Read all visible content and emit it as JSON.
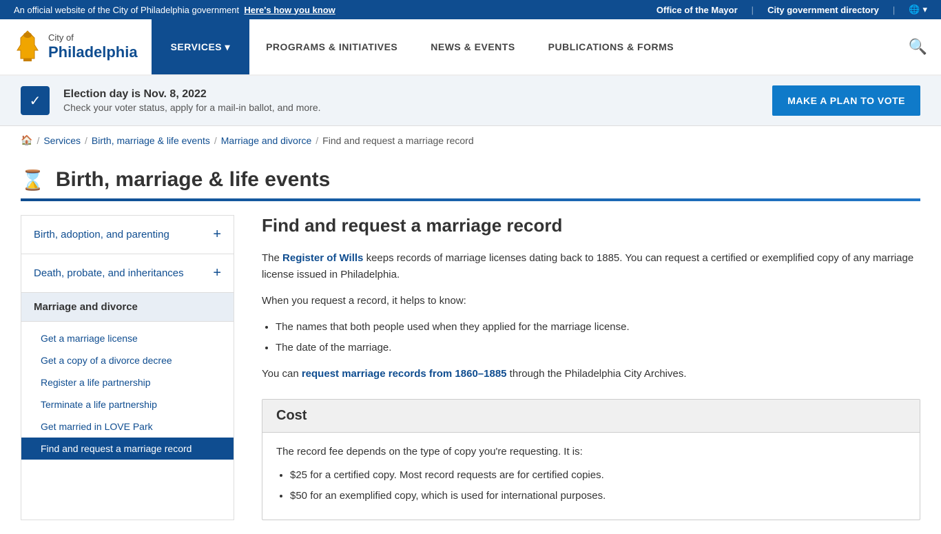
{
  "topBanner": {
    "officialText": "An official website of the City of Philadelphia government",
    "knowLink": "Here's how you know",
    "officeOfMayor": "Office of the Mayor",
    "cityDirectory": "City government directory"
  },
  "header": {
    "cityOf": "City of",
    "philadelphia": "Philadelphia",
    "nav": {
      "services": "SERVICES ▾",
      "programs": "PROGRAMS & INITIATIVES",
      "news": "NEWS & EVENTS",
      "publications": "PUBLICATIONS & FORMS"
    }
  },
  "electionBanner": {
    "title": "Election day is Nov. 8, 2022",
    "description": "Check your voter status, apply for a mail-in ballot, and more.",
    "buttonLabel": "MAKE A PLAN TO VOTE"
  },
  "breadcrumb": {
    "home": "🏠",
    "services": "Services",
    "birthMarriage": "Birth, marriage & life events",
    "marriageAndDivorce": "Marriage and divorce",
    "current": "Find and request a marriage record"
  },
  "pageTitle": "Birth, marriage & life events",
  "sidebar": {
    "items": [
      {
        "id": "birth",
        "label": "Birth, adoption, and parenting",
        "expandable": true
      },
      {
        "id": "death",
        "label": "Death, probate, and inheritances",
        "expandable": true
      }
    ],
    "activeSection": "Marriage and divorce",
    "subLinks": [
      {
        "id": "marriage-license",
        "label": "Get a marriage license",
        "active": false
      },
      {
        "id": "divorce-decree",
        "label": "Get a copy of a divorce decree",
        "active": false
      },
      {
        "id": "register-partnership",
        "label": "Register a life partnership",
        "active": false
      },
      {
        "id": "terminate-partnership",
        "label": "Terminate a life partnership",
        "active": false
      },
      {
        "id": "married-love-park",
        "label": "Get married in LOVE Park",
        "active": false
      },
      {
        "id": "find-marriage-record",
        "label": "Find and request a marriage record",
        "active": true
      }
    ]
  },
  "content": {
    "title": "Find and request a marriage record",
    "intro1Before": "The ",
    "registerOfWills": "Register of Wills",
    "intro1After": " keeps records of marriage licenses dating back to 1885. You can request a certified or exemplified copy of any marriage license issued in Philadelphia.",
    "intro2": "When you request a record, it helps to know:",
    "knowList": [
      "The names that both people used when they applied for the marriage license.",
      "The date of the marriage."
    ],
    "archivesBefore": "You can ",
    "archivesLink": "request marriage records from 1860–1885",
    "archivesAfter": " through the Philadelphia City Archives.",
    "cost": {
      "header": "Cost",
      "intro": "The record fee depends on the type of copy you're requesting. It is:",
      "items": [
        "$25 for a certified copy. Most record requests are for certified copies.",
        "$50 for an exemplified copy, which is used for international purposes."
      ]
    }
  }
}
